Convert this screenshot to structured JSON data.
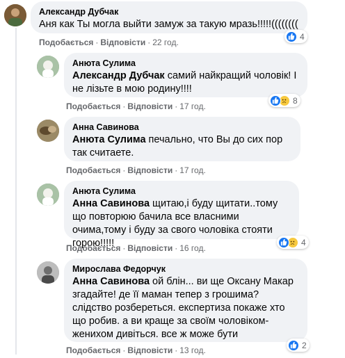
{
  "comments": [
    {
      "author": "Александр Дубчак",
      "mention": "",
      "text": "Аня как Ты могла выйти замуж за такую мразь!!!!!((((((((",
      "like_label": "Подобається",
      "reply_label": "Відповісти",
      "time": "22 год.",
      "reaction_count": "4",
      "reactions": [
        "like"
      ],
      "avatar_color": "#8e6a3e"
    },
    {
      "author": "Анюта Сулима",
      "mention": "Александр Дубчак",
      "text": " самий найкращий чоловік! І не лізьте в мою родину!!!!",
      "like_label": "Подобається",
      "reply_label": "Відповісти",
      "time": "17 год.",
      "reaction_count": "8",
      "reactions": [
        "like",
        "sad"
      ],
      "avatar_color": "#8aa38c"
    },
    {
      "author": "Анна Савинова",
      "mention": "Анюта Сулима",
      "text": " печально, что Вы до сих пор так считаете.",
      "like_label": "Подобається",
      "reply_label": "Відповісти",
      "time": "17 год.",
      "reaction_count": "",
      "reactions": [],
      "avatar_color": "#7c6b4f"
    },
    {
      "author": "Анюта Сулима",
      "mention": "Анна Савинова",
      "text": " щитаю,і буду щитати..тому що повторюю бачила все власними очима,тому і буду за свого чоловіка стояти горою!!!!!",
      "like_label": "Подобається",
      "reply_label": "Відповісти",
      "time": "16 год.",
      "reaction_count": "4",
      "reactions": [
        "like",
        "sad"
      ],
      "avatar_color": "#8aa38c"
    },
    {
      "author": "Мирослава Федорчук",
      "mention": "Анна Савинова",
      "text": " ой блін... ви ще Оксану Макар згадайте! де її маман тепер з грошима? слідство розбереться. експертиза покаже хто що робив. а ви краще за своїм чоловіком-женихом дивіться. все ж може бути",
      "like_label": "Подобається",
      "reply_label": "Відповісти",
      "time": "13 год.",
      "reaction_count": "2",
      "reactions": [
        "like"
      ],
      "avatar_color": "#9a9a9a"
    }
  ],
  "separator": "·"
}
